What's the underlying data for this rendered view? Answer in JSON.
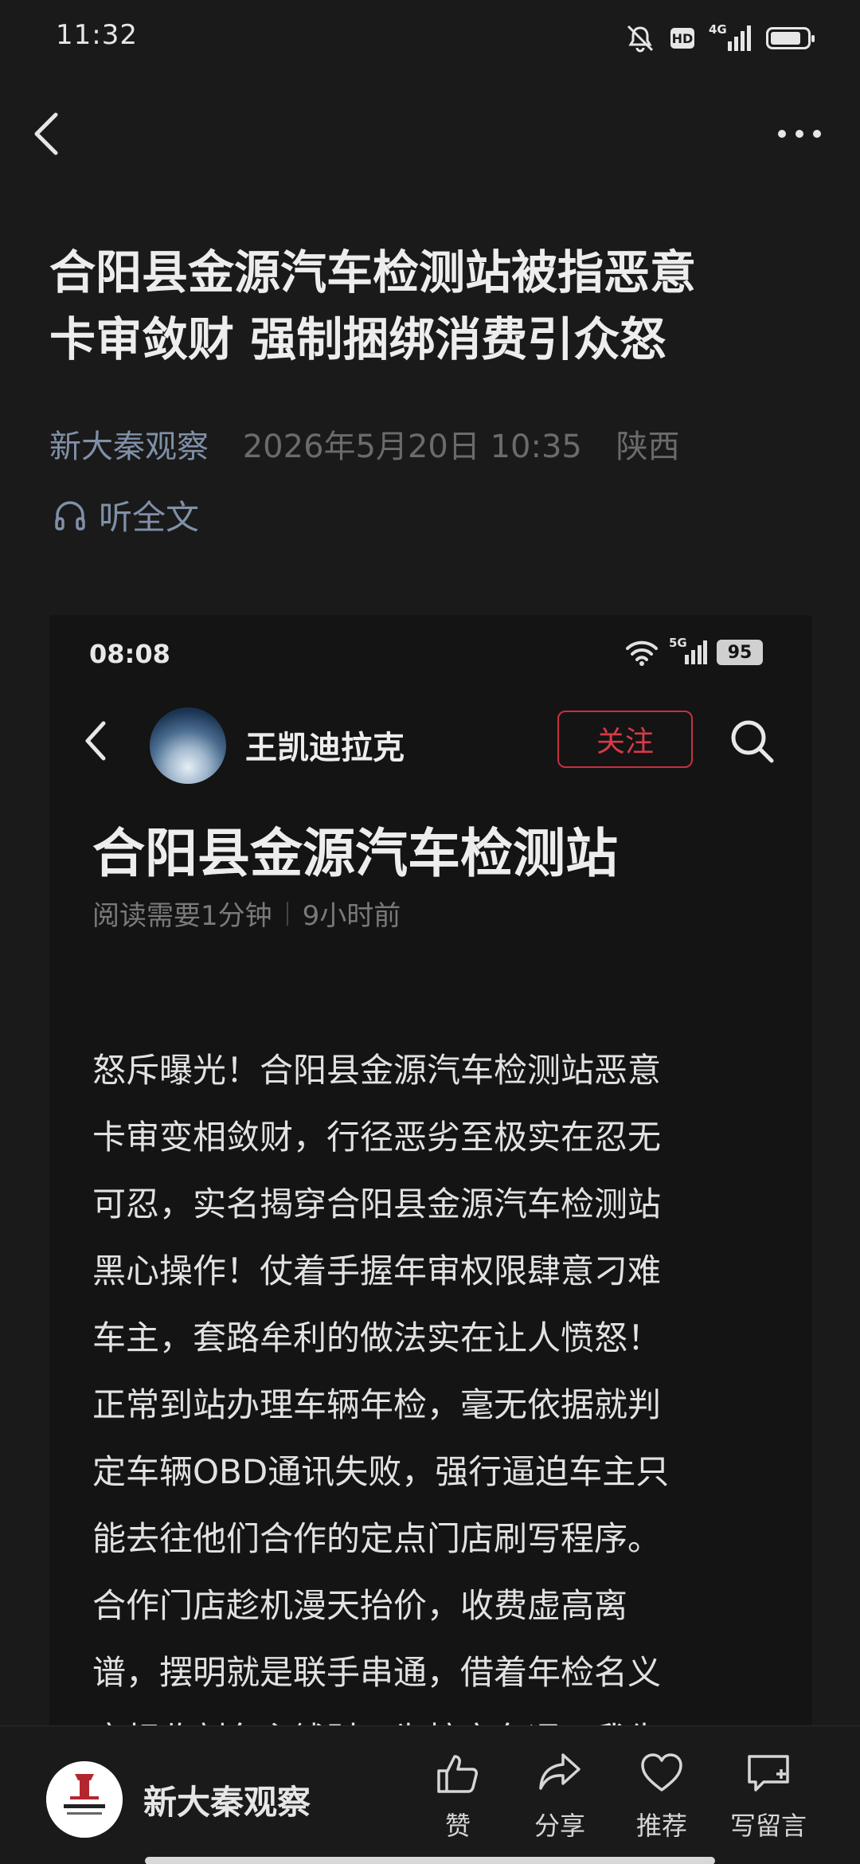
{
  "status_bar": {
    "time": "11:32",
    "hd_label": "HD",
    "network_label": "4G",
    "battery_level": 0.85
  },
  "article": {
    "title_line1": "合阳县金源汽车检测站被指恶意",
    "title_line2": "卡审敛财 强制捆绑消费引众怒",
    "source": "新大秦观察",
    "date": "2026年5月20日 10:35",
    "region": "陕西",
    "listen_label": "听全文"
  },
  "embedded": {
    "time": "08:08",
    "network_label": "5G",
    "battery": "95",
    "author": "王凯迪拉克",
    "follow_label": "关注",
    "title": "合阳县金源汽车检测站",
    "read_time": "阅读需要1分钟",
    "posted": "9小时前",
    "body_lines": [
      "怒斥曝光！合阳县金源汽车检测站恶意",
      "卡审变相敛财，行径恶劣至极实在忍无",
      "可忍，实名揭穿合阳县金源汽车检测站",
      "黑心操作！仗着手握年审权限肆意刁难",
      "车主，套路牟利的做法实在让人愤怒！",
      "正常到站办理车辆年检，毫无依据就判",
      "定车辆OBD通讯失败，强行逼迫车主只",
      "能去往他们合作的定点门店刷写程序。",
      "合作门店趁机漫天抬价，收费虚高离",
      "谱，摆明就是联手串通，借着年检名义",
      "变相收割车主钱财！为核实车况，我先"
    ]
  },
  "bottom_bar": {
    "name": "新大秦观察",
    "actions": [
      {
        "label": "赞",
        "icon": "thumbs-up-icon"
      },
      {
        "label": "分享",
        "icon": "share-icon"
      },
      {
        "label": "推荐",
        "icon": "heart-icon"
      },
      {
        "label": "写留言",
        "icon": "comment-icon"
      }
    ]
  },
  "colors": {
    "background": "#1a1a1a",
    "source_link": "#8090a8",
    "follow_red": "#d83a48"
  }
}
